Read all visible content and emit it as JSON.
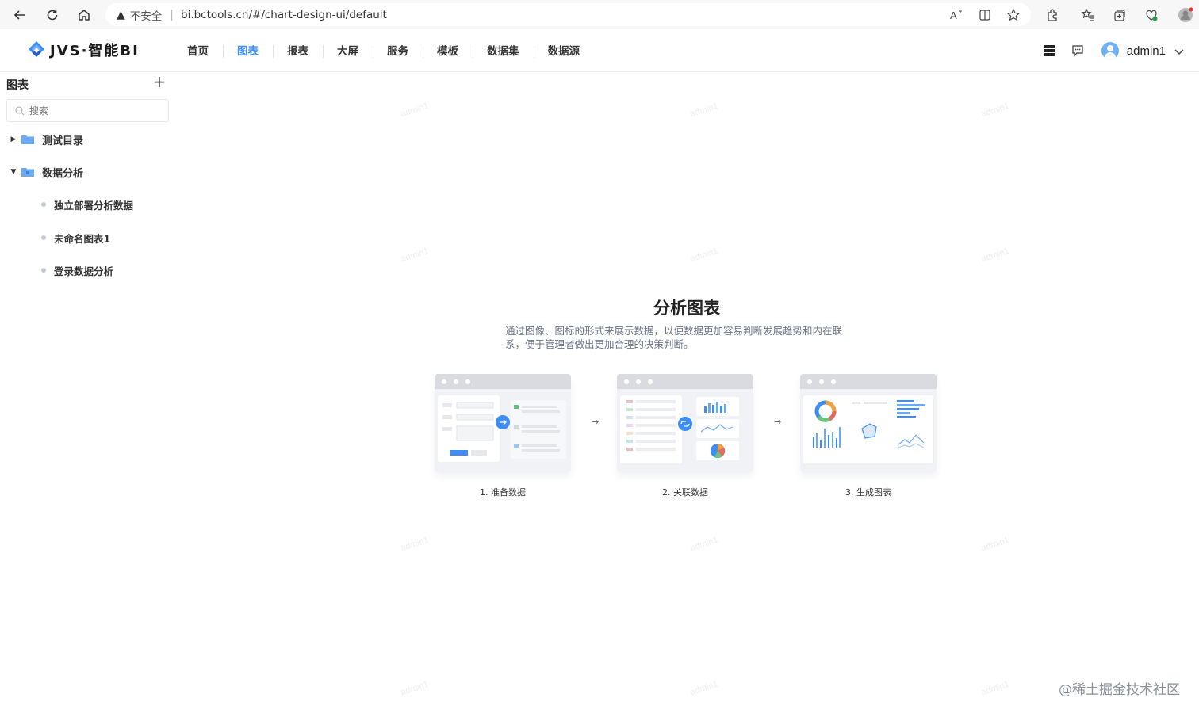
{
  "browser": {
    "insecure_label": "不安全",
    "url": "bi.bctools.cn/#/chart-design-ui/default"
  },
  "header": {
    "logo_text": "JVS·智能BI",
    "nav": [
      {
        "label": "首页",
        "active": false
      },
      {
        "label": "图表",
        "active": true
      },
      {
        "label": "报表",
        "active": false
      },
      {
        "label": "大屏",
        "active": false
      },
      {
        "label": "服务",
        "active": false
      },
      {
        "label": "模板",
        "active": false
      },
      {
        "label": "数据集",
        "active": false
      },
      {
        "label": "数据源",
        "active": false
      }
    ],
    "username": "admin1"
  },
  "sidebar": {
    "title": "图表",
    "search_placeholder": "搜索",
    "folders": [
      {
        "label": "测试目录",
        "expanded": false
      },
      {
        "label": "数据分析",
        "expanded": true
      }
    ],
    "items": [
      {
        "label": "独立部署分析数据"
      },
      {
        "label": "未命名图表1"
      },
      {
        "label": "登录数据分析"
      }
    ]
  },
  "main": {
    "title": "分析图表",
    "description": "通过图像、图标的形式来展示数据，以便数据更加容易判断发展趋势和内在联系，便于管理者做出更加合理的决策判断。",
    "steps": [
      {
        "label": "1. 准备数据"
      },
      {
        "label": "2. 关联数据"
      },
      {
        "label": "3. 生成图表"
      }
    ],
    "watermark": "admin1"
  },
  "footer_watermark": "@稀土掘金技术社区",
  "colors": {
    "accent": "#3e8cf5",
    "text": "#333333"
  }
}
